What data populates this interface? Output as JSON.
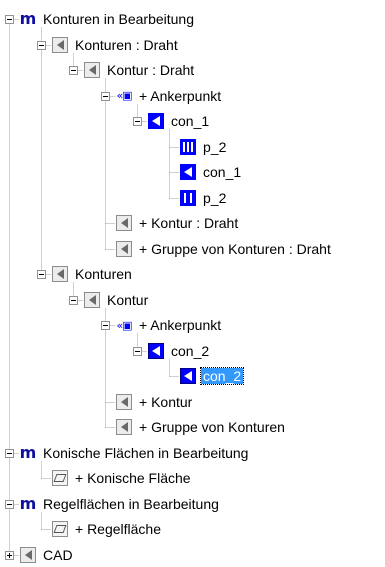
{
  "tree": {
    "nodes": [
      {
        "id": 0,
        "level": 0,
        "icon": "module-m-icon",
        "label": "Konturen in Bearbeitung",
        "toggle": "expanded"
      },
      {
        "id": 1,
        "level": 1,
        "icon": "gray-contour-icon",
        "label": "Konturen : Draht",
        "toggle": "expanded"
      },
      {
        "id": 2,
        "level": 2,
        "icon": "gray-contour-icon",
        "label": "Kontur : Draht",
        "toggle": "expanded"
      },
      {
        "id": 3,
        "level": 3,
        "icon": "anchor-point-icon",
        "label": "+ Ankerpunkt",
        "toggle": "expanded"
      },
      {
        "id": 4,
        "level": 4,
        "icon": "blue-contour-icon",
        "label": "con_1",
        "toggle": "expanded"
      },
      {
        "id": 5,
        "level": 5,
        "icon": "blue-triple-bar-icon",
        "label": "p_2",
        "toggle": "none"
      },
      {
        "id": 6,
        "level": 5,
        "icon": "blue-contour-icon",
        "label": "con_1",
        "toggle": "none"
      },
      {
        "id": 7,
        "level": 5,
        "icon": "blue-double-bar-icon",
        "label": "p_2",
        "toggle": "none"
      },
      {
        "id": 8,
        "level": 3,
        "icon": "gray-contour-icon",
        "label": "+ Kontur : Draht",
        "toggle": "none"
      },
      {
        "id": 9,
        "level": 3,
        "icon": "gray-contour-icon",
        "label": "+ Gruppe von Konturen : Draht",
        "toggle": "none"
      },
      {
        "id": 10,
        "level": 1,
        "icon": "gray-contour-icon",
        "label": "Konturen",
        "toggle": "expanded"
      },
      {
        "id": 11,
        "level": 2,
        "icon": "gray-contour-icon",
        "label": "Kontur",
        "toggle": "expanded"
      },
      {
        "id": 12,
        "level": 3,
        "icon": "anchor-point-icon",
        "label": "+ Ankerpunkt",
        "toggle": "expanded"
      },
      {
        "id": 13,
        "level": 4,
        "icon": "blue-outline-contour-icon",
        "label": "con_2",
        "toggle": "expanded"
      },
      {
        "id": 14,
        "level": 5,
        "icon": "blue-outline-contour-icon",
        "label": "con_2",
        "toggle": "none",
        "selected": true
      },
      {
        "id": 15,
        "level": 3,
        "icon": "gray-contour-icon",
        "label": "+ Kontur",
        "toggle": "none"
      },
      {
        "id": 16,
        "level": 3,
        "icon": "gray-contour-icon",
        "label": "+ Gruppe von Konturen",
        "toggle": "none"
      },
      {
        "id": 17,
        "level": 0,
        "icon": "module-m-icon",
        "label": "Konische Flächen in Bearbeitung",
        "toggle": "expanded"
      },
      {
        "id": 18,
        "level": 1,
        "icon": "surface-icon",
        "label": "+ Konische Fläche",
        "toggle": "none"
      },
      {
        "id": 19,
        "level": 0,
        "icon": "module-m-icon",
        "label": "Regelflächen in Bearbeitung",
        "toggle": "expanded"
      },
      {
        "id": 20,
        "level": 1,
        "icon": "surface-icon",
        "label": "+ Regelfläche",
        "toggle": "none"
      },
      {
        "id": 21,
        "level": 0,
        "icon": "gray-contour-icon",
        "label": "CAD",
        "toggle": "collapsed"
      }
    ],
    "colors": {
      "selection_background": "#3399ff",
      "selection_text": "#ffffff",
      "module_icon": "#1010a0",
      "blue_icon": "#0000ff",
      "tree_lines": "#a0a0a0"
    }
  }
}
